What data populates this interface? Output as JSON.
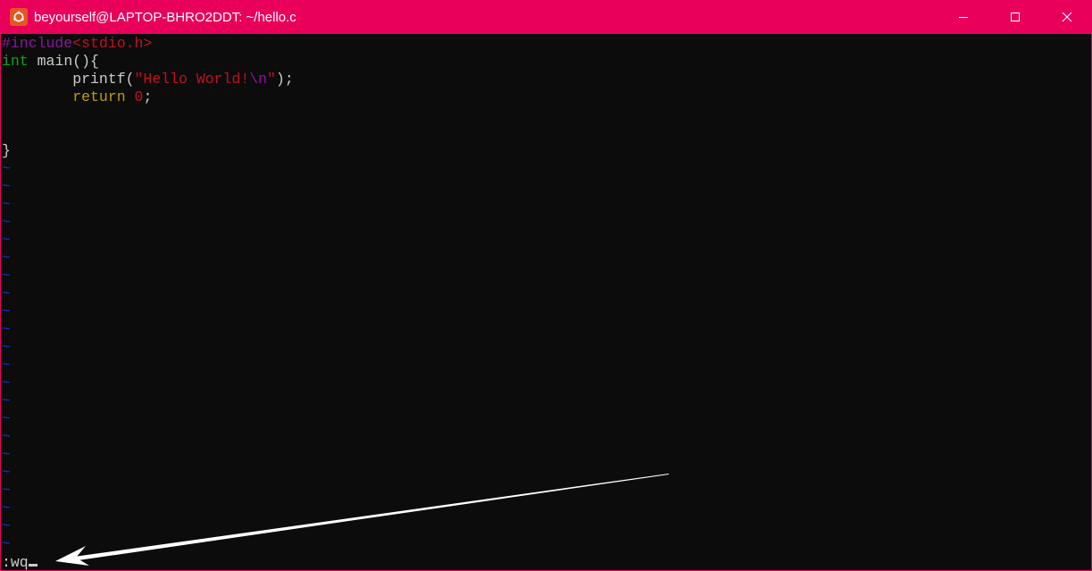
{
  "window": {
    "title": "beyourself@LAPTOP-BHRO2DDT: ~/hello.c",
    "titlebar_color": "#e8005a"
  },
  "editor": {
    "lines": {
      "l1": {
        "directive": "#include",
        "header": "<stdio.h>"
      },
      "l2": {
        "type": "int",
        "rest": " main(){"
      },
      "l3": {
        "indent": "        ",
        "func": "printf(",
        "str_open": "\"Hello World!",
        "esc": "\\n",
        "str_close": "\"",
        "end": ");"
      },
      "l4": {
        "indent": "        ",
        "kw": "return",
        "space": " ",
        "num": "0",
        "end": ";"
      },
      "l5": "",
      "l6": "",
      "l7": "}"
    },
    "empty_line_marker": "~",
    "empty_line_count": 22,
    "command_line": ":wq"
  },
  "annotation": {
    "type": "arrow",
    "color": "#ffffff",
    "points_to": "command-line"
  }
}
